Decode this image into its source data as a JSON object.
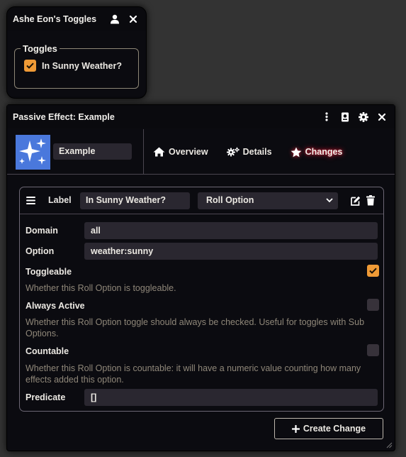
{
  "toggles_window": {
    "title": "Ashe Eon's Toggles",
    "fieldset_legend": "Toggles",
    "toggle_label": "In Sunny Weather?",
    "toggle_checked": true
  },
  "effect_window": {
    "title": "Passive Effect: Example",
    "item_name": "Example",
    "tabs": [
      {
        "label": "Overview",
        "icon": "home-icon"
      },
      {
        "label": "Details",
        "icon": "cogs-icon"
      },
      {
        "label": "Changes",
        "icon": "star-icon",
        "active": true
      }
    ],
    "change": {
      "label_key": "Label",
      "label_value": "In Sunny Weather?",
      "type_value": "Roll Option",
      "domain_key": "Domain",
      "domain_value": "all",
      "option_key": "Option",
      "option_value": "weather:sunny",
      "toggleable_key": "Toggleable",
      "toggleable_checked": true,
      "toggleable_hint": "Whether this Roll Option is toggleable.",
      "always_active_key": "Always Active",
      "always_active_checked": false,
      "always_active_hint": "Whether this Roll Option toggle should always be checked. Useful for toggles with Sub Options.",
      "countable_key": "Countable",
      "countable_checked": false,
      "countable_hint": "Whether this Roll Option is countable: it will have a numeric value counting how many effects added this option.",
      "predicate_key": "Predicate",
      "predicate_value": "[]"
    },
    "create_button": "Create Change"
  },
  "colors": {
    "accent": "#ef9a36",
    "active_tab_glow": "#e0233c",
    "avatar_bg": "#4a78dc"
  }
}
